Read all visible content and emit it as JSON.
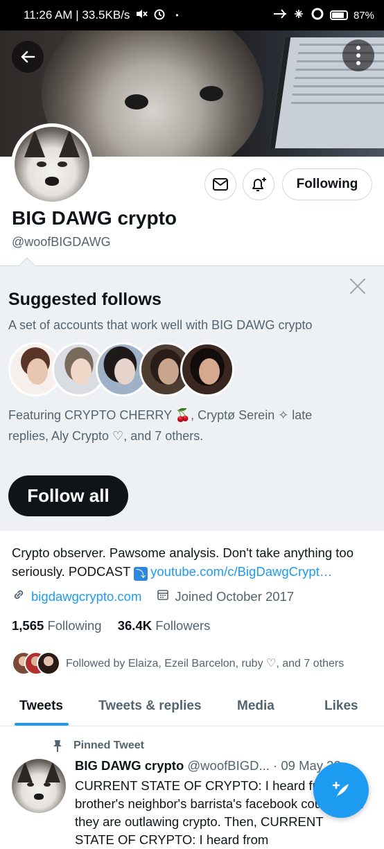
{
  "status_bar": {
    "time_info": "11:26 AM | 33.5KB/s",
    "dot": "•",
    "battery": "87%",
    "battery_level": 0.87
  },
  "profile": {
    "name": "BIG DAWG crypto",
    "handle": "@woofBIGDAWG",
    "following_button": "Following",
    "bio_text": "Crypto observer. Pawsome analysis. Don't take anything too seriously. PODCAST",
    "bio_link": "youtube.com/c/BigDawgCrypt…",
    "website": "bigdawgcrypto.com",
    "joined": "Joined October 2017",
    "following_count": "1,565",
    "following_label": "Following",
    "followers_count": "36.4K",
    "followers_label": "Followers",
    "followed_by": "Followed by Elaiza, Ezeil Barcelon, ruby ♡, and 7 others"
  },
  "suggested": {
    "title": "Suggested follows",
    "subtitle": "A set of accounts that work well with BIG DAWG crypto",
    "featuring": "Featuring CRYPTO CHERRY 🍒, Cryptø Serein ✧ late replies, Aly Crypto ♡, and 7 others.",
    "follow_all": "Follow all"
  },
  "tabs": [
    "Tweets",
    "Tweets & replies",
    "Media",
    "Likes"
  ],
  "tweet": {
    "pinned_label": "Pinned Tweet",
    "author": "BIG DAWG crypto",
    "meta": "@woofBIGD... · 09 May 22",
    "text": "CURRENT STATE OF CRYPTO: I heard from my brother's neighbor's barrista's facebook cousin that they are outlawing crypto. Then, CURRENT STATE OF CRYPTO: I heard from"
  },
  "icons": {
    "back": "back-arrow-icon",
    "more": "more-vertical-icon",
    "mail": "mail-icon",
    "bell": "bell-plus-icon",
    "close": "close-icon",
    "link": "link-icon",
    "calendar": "calendar-icon",
    "pin": "pin-icon",
    "compose": "compose-tweet-icon"
  },
  "colors": {
    "accent": "#1d9bf0",
    "text": "#0f1419",
    "muted": "#536471",
    "suggest_bg": "#eef1f3"
  }
}
